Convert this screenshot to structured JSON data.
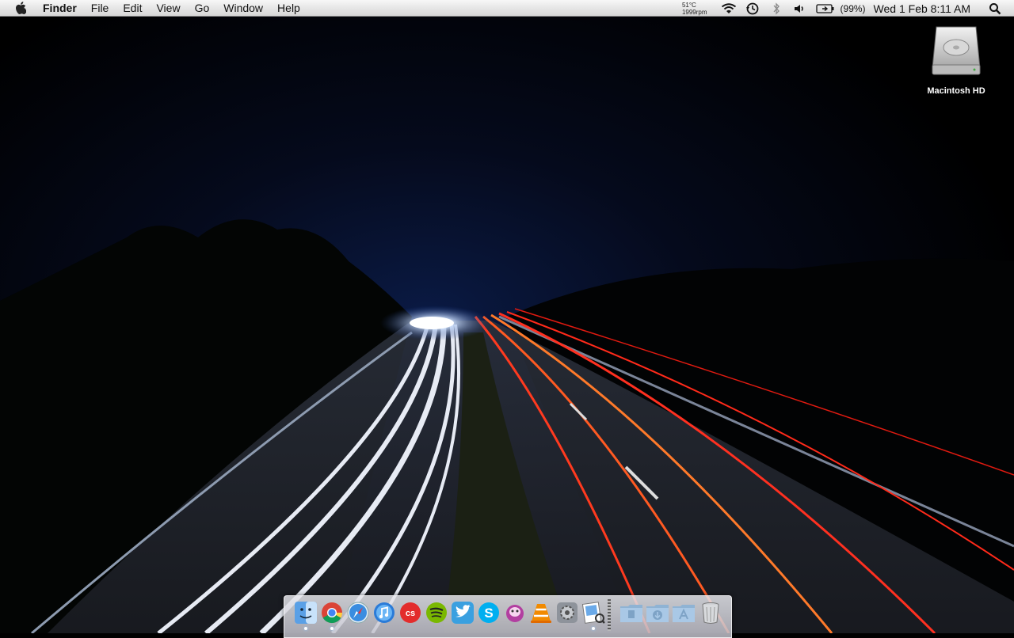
{
  "menubar": {
    "app_name": "Finder",
    "menus": [
      "File",
      "Edit",
      "View",
      "Go",
      "Window",
      "Help"
    ],
    "temperature": "51°C",
    "fan_speed": "1999rpm",
    "battery_percent": "(99%)",
    "clock": "Wed 1 Feb  8:11 AM",
    "icons": [
      "apple-icon",
      "wifi-icon",
      "time-machine-icon",
      "bluetooth-icon",
      "volume-icon",
      "battery-icon",
      "spotlight-icon"
    ]
  },
  "desktop": {
    "icons": [
      {
        "label": "Macintosh HD",
        "icon": "hard-drive-icon"
      }
    ]
  },
  "dock": {
    "items": [
      {
        "name": "finder",
        "icon": "finder-icon",
        "running": true
      },
      {
        "name": "chrome",
        "icon": "chrome-icon",
        "running": true
      },
      {
        "name": "safari",
        "icon": "safari-icon",
        "running": false
      },
      {
        "name": "itunes",
        "icon": "itunes-icon",
        "running": false
      },
      {
        "name": "lastfm",
        "icon": "lastfm-icon",
        "running": false
      },
      {
        "name": "spotify",
        "icon": "spotify-icon",
        "running": false
      },
      {
        "name": "twitter",
        "icon": "twitter-icon",
        "running": false
      },
      {
        "name": "skype",
        "icon": "skype-icon",
        "running": false
      },
      {
        "name": "adium",
        "icon": "adium-icon",
        "running": false
      },
      {
        "name": "vlc",
        "icon": "vlc-icon",
        "running": false
      },
      {
        "name": "system-preferences",
        "icon": "system-preferences-icon",
        "running": false
      },
      {
        "name": "preview",
        "icon": "preview-icon",
        "running": true
      }
    ],
    "stacks": [
      {
        "name": "documents",
        "icon": "documents-folder-icon"
      },
      {
        "name": "downloads",
        "icon": "downloads-folder-icon"
      },
      {
        "name": "applications",
        "icon": "applications-folder-icon"
      },
      {
        "name": "trash",
        "icon": "trash-icon"
      }
    ]
  }
}
